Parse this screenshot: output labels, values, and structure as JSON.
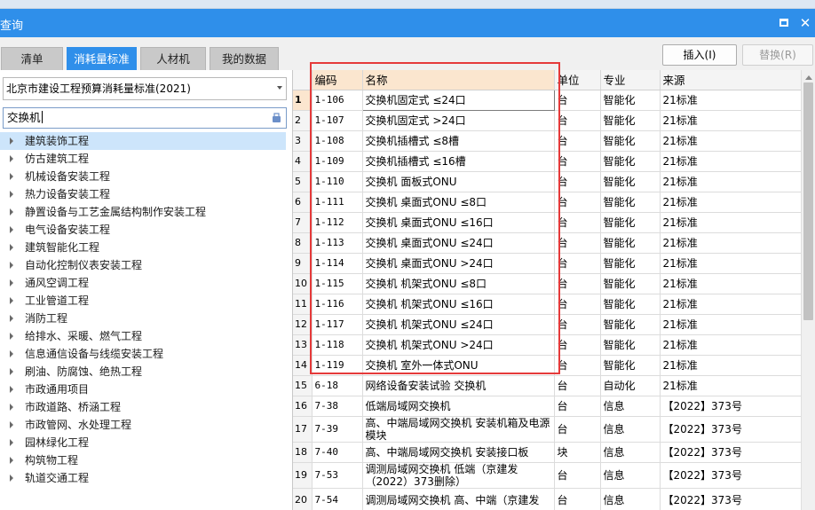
{
  "window": {
    "title": "查询"
  },
  "tabs": [
    {
      "label": "清单",
      "active": false
    },
    {
      "label": "消耗量标准",
      "active": true
    },
    {
      "label": "人材机",
      "active": false
    },
    {
      "label": "我的数据",
      "active": false
    }
  ],
  "toolbar": {
    "insert_label": "插入(I)",
    "replace_label": "替换(R)"
  },
  "left": {
    "standard_selected": "北京市建设工程预算消耗量标准(2021)",
    "search_value": "交换机",
    "tree": [
      "建筑装饰工程",
      "仿古建筑工程",
      "机械设备安装工程",
      "热力设备安装工程",
      "静置设备与工艺金属结构制作安装工程",
      "电气设备安装工程",
      "建筑智能化工程",
      "自动化控制仪表安装工程",
      "通风空调工程",
      "工业管道工程",
      "消防工程",
      "给排水、采暖、燃气工程",
      "信息通信设备与线缆安装工程",
      "刷油、防腐蚀、绝热工程",
      "市政通用项目",
      "市政道路、桥涵工程",
      "市政管网、水处理工程",
      "园林绿化工程",
      "构筑物工程",
      "轨道交通工程"
    ]
  },
  "table": {
    "headers": {
      "rownum": "",
      "code": "编码",
      "name": "名称",
      "unit": "单位",
      "major": "专业",
      "source": "来源"
    },
    "rows": [
      {
        "n": "1",
        "code": "1-106",
        "name": "交换机固定式 ≤24口",
        "unit": "台",
        "major": "智能化",
        "source": "21标准"
      },
      {
        "n": "2",
        "code": "1-107",
        "name": "交换机固定式 >24口",
        "unit": "台",
        "major": "智能化",
        "source": "21标准"
      },
      {
        "n": "3",
        "code": "1-108",
        "name": "交换机插槽式 ≤8槽",
        "unit": "台",
        "major": "智能化",
        "source": "21标准"
      },
      {
        "n": "4",
        "code": "1-109",
        "name": "交换机插槽式 ≤16槽",
        "unit": "台",
        "major": "智能化",
        "source": "21标准"
      },
      {
        "n": "5",
        "code": "1-110",
        "name": "交换机 面板式ONU",
        "unit": "台",
        "major": "智能化",
        "source": "21标准"
      },
      {
        "n": "6",
        "code": "1-111",
        "name": "交换机 桌面式ONU ≤8口",
        "unit": "台",
        "major": "智能化",
        "source": "21标准"
      },
      {
        "n": "7",
        "code": "1-112",
        "name": "交换机 桌面式ONU ≤16口",
        "unit": "台",
        "major": "智能化",
        "source": "21标准"
      },
      {
        "n": "8",
        "code": "1-113",
        "name": "交换机 桌面式ONU ≤24口",
        "unit": "台",
        "major": "智能化",
        "source": "21标准"
      },
      {
        "n": "9",
        "code": "1-114",
        "name": "交换机 桌面式ONU >24口",
        "unit": "台",
        "major": "智能化",
        "source": "21标准"
      },
      {
        "n": "10",
        "code": "1-115",
        "name": "交换机 机架式ONU ≤8口",
        "unit": "台",
        "major": "智能化",
        "source": "21标准"
      },
      {
        "n": "11",
        "code": "1-116",
        "name": "交换机 机架式ONU ≤16口",
        "unit": "台",
        "major": "智能化",
        "source": "21标准"
      },
      {
        "n": "12",
        "code": "1-117",
        "name": "交换机 机架式ONU ≤24口",
        "unit": "台",
        "major": "智能化",
        "source": "21标准"
      },
      {
        "n": "13",
        "code": "1-118",
        "name": "交换机 机架式ONU >24口",
        "unit": "台",
        "major": "智能化",
        "source": "21标准"
      },
      {
        "n": "14",
        "code": "1-119",
        "name": "交换机 室外一体式ONU",
        "unit": "台",
        "major": "智能化",
        "source": "21标准"
      },
      {
        "n": "15",
        "code": "6-18",
        "name": "网络设备安装试验 交换机",
        "unit": "台",
        "major": "自动化",
        "source": "21标准"
      },
      {
        "n": "16",
        "code": "7-38",
        "name": "低端局域网交换机",
        "unit": "台",
        "major": "信息",
        "source": "【2022】373号"
      },
      {
        "n": "17",
        "code": "7-39",
        "name": "高、中端局域网交换机 安装机箱及电源模块",
        "unit": "台",
        "major": "信息",
        "source": "【2022】373号"
      },
      {
        "n": "18",
        "code": "7-40",
        "name": "高、中端局域网交换机 安装接口板",
        "unit": "块",
        "major": "信息",
        "source": "【2022】373号"
      },
      {
        "n": "19",
        "code": "7-53",
        "name": "调测局域网交换机 低端（京建发（2022）373删除）",
        "unit": "台",
        "major": "信息",
        "source": "【2022】373号"
      },
      {
        "n": "20",
        "code": "7-54",
        "name": "调测局域网交换机 高、中端（京建发",
        "unit": "台",
        "major": "信息",
        "source": "【2022】373号"
      }
    ]
  }
}
